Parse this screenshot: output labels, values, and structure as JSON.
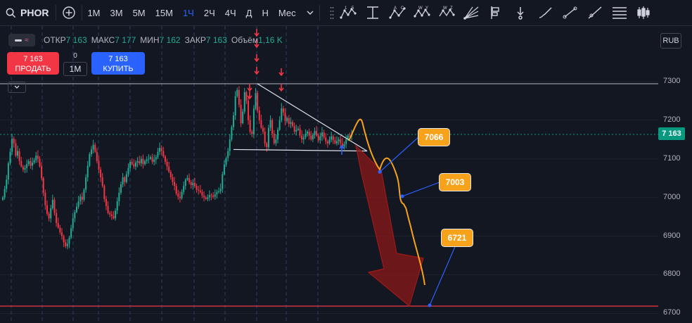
{
  "toolbar": {
    "symbol": "PHOR",
    "timeframes": [
      "1M",
      "3M",
      "5M",
      "15M",
      "1Ч",
      "2Ч",
      "4Ч",
      "Д",
      "Н",
      "Мес"
    ],
    "active_timeframe": "1Ч"
  },
  "tool_icons": [
    "pattern-15-icon",
    "fib-extension-icon",
    "abcd-pattern-icon",
    "wxy-pattern-icon",
    "wxyz-pattern-icon",
    "gann-fan-icon",
    "price-label-icon",
    "arrow-marker-icon",
    "brush-icon",
    "trend-line-icon",
    "ray-line-icon",
    "horizontal-lines-icon",
    "indicators-icon"
  ],
  "tool_letters": [
    "1 5",
    "",
    "A C",
    "W Y",
    "W Z",
    "",
    "",
    "",
    "",
    "",
    "",
    "",
    ""
  ],
  "header": {
    "open_label": "ОТКР",
    "open": "7 163",
    "high_label": "МАКС",
    "high": "7 177",
    "low_label": "МИН",
    "low": "7 162",
    "close_label": "ЗАКР",
    "close": "7 163",
    "volume_label": "Объём",
    "volume": "1,16 K"
  },
  "trade": {
    "sell_price": "7 163",
    "sell_label": "ПРОДАТЬ",
    "buy_price": "7 163",
    "buy_label": "КУПИТЬ",
    "qty_top": "0",
    "qty": "1М"
  },
  "axis": {
    "currency": "RUB",
    "labels": [
      "7300",
      "7200",
      "7100",
      "7000",
      "6900",
      "6800",
      "6700"
    ],
    "current_price": "7 163"
  },
  "callouts": [
    "7066",
    "7003",
    "6721"
  ],
  "colors": {
    "background": "#131722",
    "up": "#22ab94",
    "down": "#f23645",
    "accent": "#2962ff",
    "forecast": "#f7a21b",
    "arrow": "#8b1a1a"
  },
  "chart_data": {
    "type": "candlestick",
    "ylim": [
      6680,
      7340
    ],
    "current_price": 7163,
    "horizontal_lines": [
      7294,
      6719
    ],
    "triangle": {
      "apex_high": 7294,
      "base": 7124
    },
    "forecast_targets": [
      7066,
      7003,
      6721
    ],
    "closes": [
      7000,
      7022,
      7046,
      7088,
      7118,
      7152,
      7140,
      7108,
      7120,
      7094,
      7080,
      7072,
      7076,
      7086,
      7094,
      7082,
      7090,
      7096,
      7108,
      7100,
      7080,
      7050,
      7012,
      6980,
      6958,
      6946,
      6972,
      6994,
      6960,
      6934,
      6922,
      6910,
      6900,
      6884,
      6874,
      6880,
      6896,
      6920,
      6946,
      6962,
      6976,
      6990,
      7002,
      6994,
      7020,
      7052,
      7082,
      7112,
      7124,
      7136,
      7118,
      7094,
      7072,
      7052,
      7030,
      6996,
      6978,
      6960,
      6956,
      6952,
      6946,
      6966,
      6990,
      7012,
      7034,
      7052,
      7040,
      7060,
      7076,
      7092,
      7086,
      7080,
      7090,
      7094,
      7088,
      7100,
      7086,
      7094,
      7098,
      7100,
      7104,
      7092,
      7098,
      7104,
      7118,
      7128,
      7120,
      7106,
      7092,
      7080,
      7066,
      7052,
      7040,
      7030,
      7010,
      7002,
      6998,
      7014,
      7030,
      7046,
      7050,
      7040,
      7032,
      7038,
      7030,
      7020,
      7018,
      7014,
      7005,
      7000,
      6996,
      7000,
      7006,
      7005,
      7002,
      7008,
      7014,
      7016,
      7022,
      7060,
      7085,
      7102,
      7120,
      7150,
      7182,
      7212,
      7262,
      7278,
      7240,
      7192,
      7222,
      7272,
      7250,
      7200,
      7170,
      7164,
      7230,
      7270,
      7225,
      7200,
      7180,
      7170,
      7140,
      7130,
      7180,
      7200,
      7165,
      7140,
      7150,
      7175,
      7200,
      7230,
      7220,
      7198,
      7205,
      7190,
      7195,
      7185,
      7170,
      7175,
      7178,
      7160,
      7150,
      7155,
      7165,
      7170,
      7160,
      7150,
      7162,
      7172,
      7160,
      7148,
      7158,
      7168,
      7155,
      7145,
      7140,
      7150,
      7158,
      7148,
      7140,
      7145,
      7150,
      7140,
      7132,
      7138,
      7150,
      7160,
      7158,
      7163
    ]
  }
}
